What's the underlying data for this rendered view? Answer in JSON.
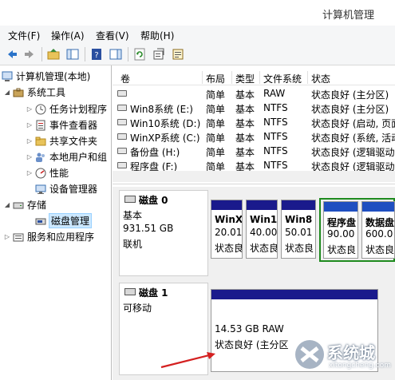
{
  "window": {
    "title": "计算机管理"
  },
  "menu": [
    "文件(F)",
    "操作(A)",
    "查看(V)",
    "帮助(H)"
  ],
  "toolbar": [
    "back-icon",
    "forward-icon",
    "up-folder-icon",
    "show-hide-tree-icon",
    "help-icon",
    "action-pane-icon",
    "refresh-icon",
    "properties-icon",
    "export-list-icon"
  ],
  "tree": {
    "root": "计算机管理(本地)",
    "system_tools": "系统工具",
    "task_scheduler": "任务计划程序",
    "event_viewer": "事件查看器",
    "shared_folders": "共享文件夹",
    "local_users": "本地用户和组",
    "performance": "性能",
    "device_manager": "设备管理器",
    "storage": "存储",
    "disk_management": "磁盘管理",
    "services_apps": "服务和应用程序"
  },
  "volume_list": {
    "columns": [
      "卷",
      "布局",
      "类型",
      "文件系统",
      "状态"
    ],
    "rows": [
      {
        "name": "",
        "layout": "简单",
        "type": "基本",
        "fs": "RAW",
        "status": "状态良好 (主分区)"
      },
      {
        "name": "Win8系统 (E:)",
        "layout": "简单",
        "type": "基本",
        "fs": "NTFS",
        "status": "状态良好 (主分区)"
      },
      {
        "name": "Win10系统 (D:)",
        "layout": "简单",
        "type": "基本",
        "fs": "NTFS",
        "status": "状态良好 (启动, 页面"
      },
      {
        "name": "WinXP系统 (C:)",
        "layout": "简单",
        "type": "基本",
        "fs": "NTFS",
        "status": "状态良好 (系统, 活动"
      },
      {
        "name": "备份盘 (H:)",
        "layout": "简单",
        "type": "基本",
        "fs": "NTFS",
        "status": "状态良好 (逻辑驱动"
      },
      {
        "name": "程序盘 (F:)",
        "layout": "简单",
        "type": "基本",
        "fs": "NTFS",
        "status": "状态良好 (逻辑驱动"
      }
    ]
  },
  "disk0": {
    "name": "磁盘 0",
    "kind": "基本",
    "size": "931.51 GB",
    "state": "联机",
    "partitions": [
      {
        "name": "WinX",
        "size": "20.01",
        "status": "状态良"
      },
      {
        "name": "Win1",
        "size": "40.00",
        "status": "状态良"
      },
      {
        "name": "Win8",
        "size": "50.01",
        "status": "状态良"
      },
      {
        "name": "程序盘",
        "size": "90.00",
        "status": "状态良"
      },
      {
        "name": "数据盘",
        "size": "600.0",
        "status": "状态良"
      }
    ]
  },
  "disk1": {
    "name": "磁盘 1",
    "kind": "可移动",
    "partition": {
      "size": "14.53 GB RAW",
      "status": "状态良好 (主分区"
    }
  },
  "watermark": {
    "text": "系统城",
    "sub": "xitongcheng.com"
  },
  "colors": {
    "primary_bar": "#1a1a8c",
    "logical_bar": "#1f4fc0",
    "extended_border": "#1e8a1e",
    "arrow": "#d42020"
  }
}
